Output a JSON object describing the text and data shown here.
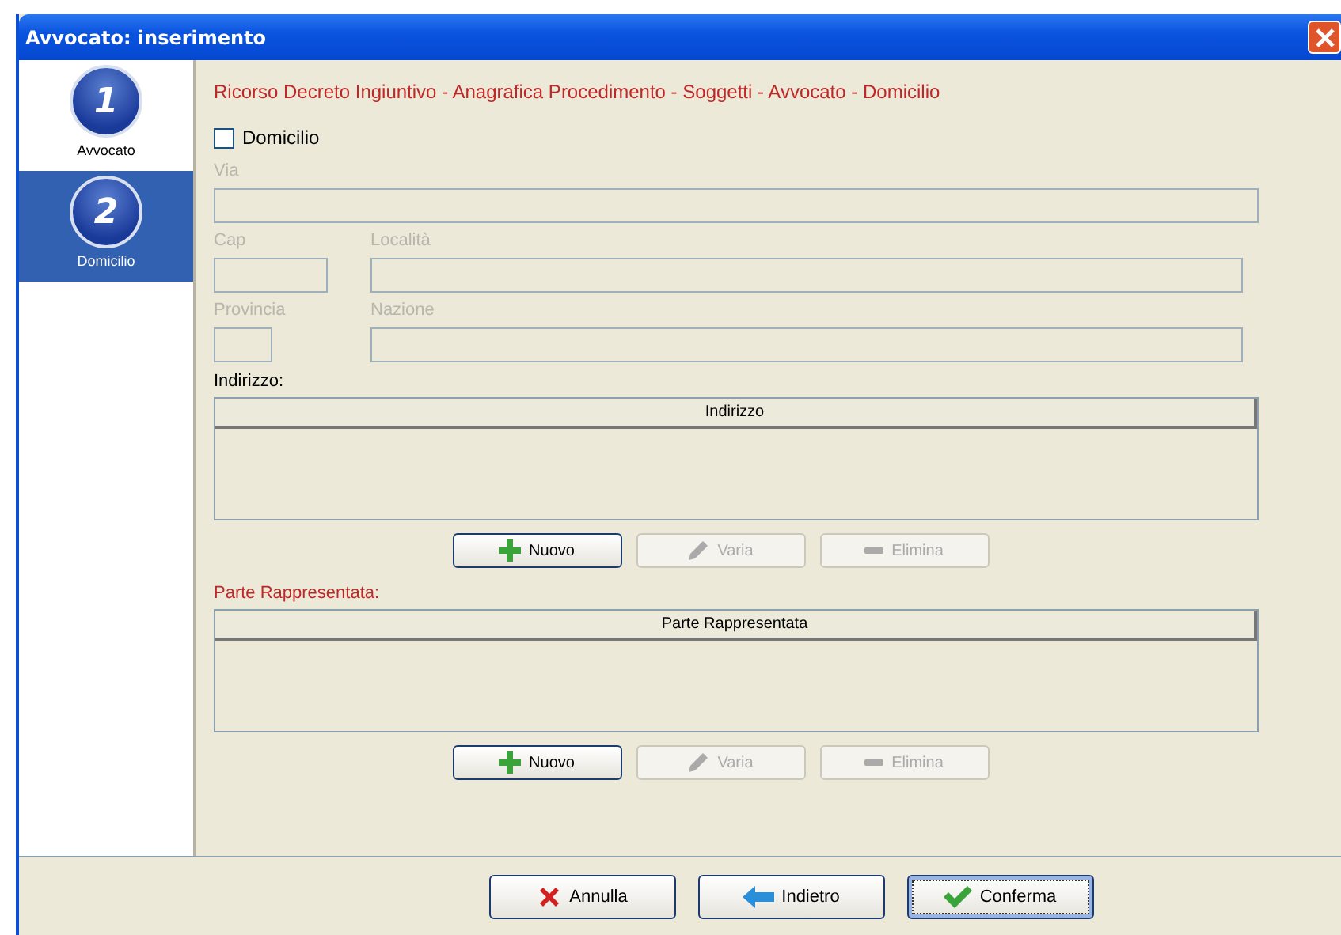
{
  "window": {
    "title": "Avvocato: inserimento"
  },
  "steps": [
    {
      "number": "1",
      "label": "Avvocato",
      "selected": false
    },
    {
      "number": "2",
      "label": "Domicilio",
      "selected": true
    }
  ],
  "breadcrumb": "Ricorso Decreto Ingiuntivo - Anagrafica Procedimento - Soggetti - Avvocato - Domicilio",
  "domicilio_checkbox": {
    "label": "Domicilio",
    "checked": false
  },
  "field_rows": [
    [
      {
        "label": "Via",
        "kind": "full",
        "disabled": true
      }
    ],
    [
      {
        "label": "Cap",
        "kind": "small",
        "disabled": true
      },
      {
        "label": "Località",
        "kind": "wide",
        "disabled": true
      }
    ],
    [
      {
        "label": "Provincia",
        "kind": "tiny",
        "disabled": true
      },
      {
        "label": "Nazione",
        "kind": "wide",
        "disabled": true
      }
    ]
  ],
  "tables": [
    {
      "label": "Indirizzo:",
      "required": false,
      "column": "Indirizzo",
      "buttons": [
        {
          "label": "Nuovo",
          "kind": "add",
          "disabled": false
        },
        {
          "label": "Varia",
          "kind": "edit",
          "disabled": true
        },
        {
          "label": "Elimina",
          "kind": "remove",
          "disabled": true
        }
      ]
    },
    {
      "label": "Parte Rappresentata:",
      "required": true,
      "column": "Parte Rappresentata",
      "buttons": [
        {
          "label": "Nuovo",
          "kind": "add",
          "disabled": false
        },
        {
          "label": "Varia",
          "kind": "edit",
          "disabled": true
        },
        {
          "label": "Elimina",
          "kind": "remove",
          "disabled": true
        }
      ]
    }
  ],
  "footer_buttons": [
    {
      "label": "Annulla",
      "kind": "cancel",
      "focused": false
    },
    {
      "label": "Indietro",
      "kind": "back",
      "focused": false
    },
    {
      "label": "Conferma",
      "kind": "confirm",
      "focused": true
    }
  ]
}
